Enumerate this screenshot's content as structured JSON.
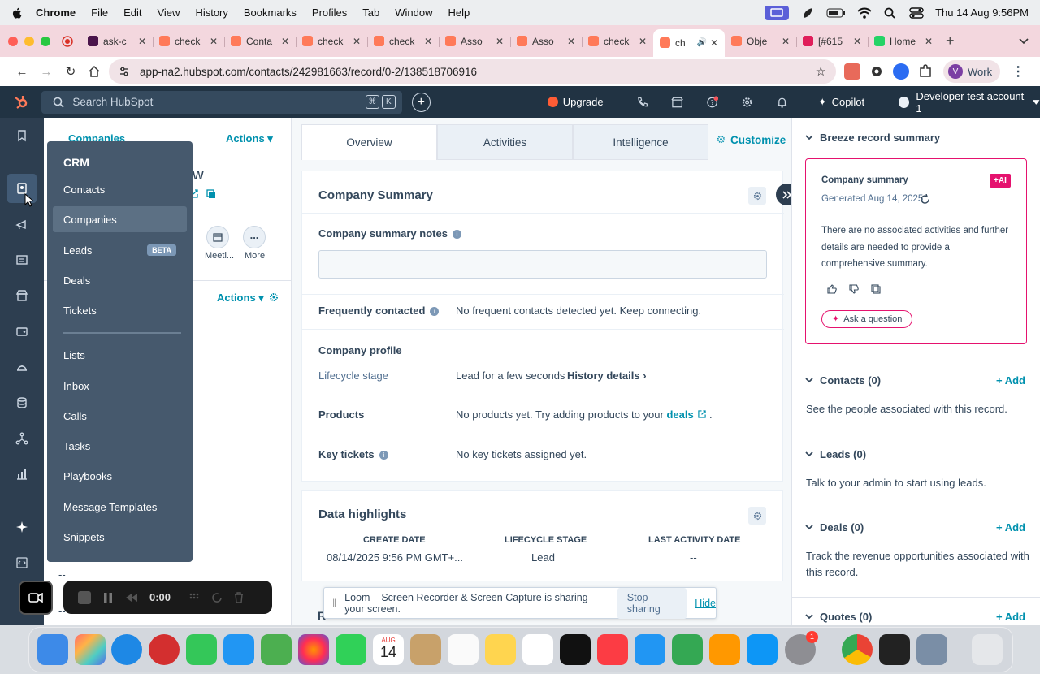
{
  "menubar": {
    "app": "Chrome",
    "items": [
      "File",
      "Edit",
      "View",
      "History",
      "Bookmarks",
      "Profiles",
      "Tab",
      "Window",
      "Help"
    ],
    "datetime": "Thu 14 Aug  9:56PM"
  },
  "tabs": [
    {
      "label": "ask-c",
      "fav": "#4a154b"
    },
    {
      "label": "check",
      "fav": "#ff7a59"
    },
    {
      "label": "Conta",
      "fav": "#ff7a59"
    },
    {
      "label": "check",
      "fav": "#ff7a59"
    },
    {
      "label": "check",
      "fav": "#ff7a59"
    },
    {
      "label": "Asso",
      "fav": "#ff7a59"
    },
    {
      "label": "Asso",
      "fav": "#ff7a59"
    },
    {
      "label": "check",
      "fav": "#ff7a59"
    },
    {
      "label": "ch",
      "fav": "#ff7a59",
      "active": true
    },
    {
      "label": "Obje",
      "fav": "#ff7a59"
    },
    {
      "label": "[#615",
      "fav": "#e01e5a"
    },
    {
      "label": "Home",
      "fav": "#25d366"
    }
  ],
  "address": {
    "url": "app-na2.hubspot.com/contacts/242981663/record/0-2/138518706916",
    "profile_initial": "V",
    "profile_label": "Work"
  },
  "hsnav": {
    "search_placeholder": "Search HubSpot",
    "kbd1": "⌘",
    "kbd2": "K",
    "upgrade": "Upgrade",
    "copilot": "Copilot",
    "account": "Developer test account 1"
  },
  "left": {
    "breadcrumb": "Companies",
    "actions": "Actions",
    "name_fragment": "w",
    "meeting": "Meeti...",
    "more": "More",
    "actions2": "Actions",
    "dash1": "--",
    "dash2": "--"
  },
  "crm": {
    "title": "CRM",
    "beta": "BETA",
    "items": [
      "Contacts",
      "Companies",
      "Leads",
      "Deals",
      "Tickets",
      "Lists",
      "Inbox",
      "Calls",
      "Tasks",
      "Playbooks",
      "Message Templates",
      "Snippets"
    ]
  },
  "center": {
    "tabs": [
      "Overview",
      "Activities",
      "Intelligence"
    ],
    "customize": "Customize",
    "summary_title": "Company Summary",
    "notes_label": "Company summary notes",
    "freq_label": "Frequently contacted",
    "freq_value": "No frequent contacts detected yet. Keep connecting.",
    "profile_label": "Company profile",
    "lifecycle_label": "Lifecycle stage",
    "lifecycle_value": "Lead for a few seconds",
    "history_link": "History details",
    "products_label": "Products",
    "products_value": "No products yet. Try adding products to your",
    "deals_link": "deals",
    "period": ".",
    "tickets_label": "Key tickets",
    "tickets_value": "No key tickets assigned yet.",
    "highlights_title": "Data highlights",
    "highlights": {
      "headers": [
        "CREATE DATE",
        "LIFECYCLE STAGE",
        "LAST ACTIVITY DATE"
      ],
      "values": [
        "08/14/2025 9:56 PM GMT+...",
        "Lead",
        "--"
      ]
    },
    "r_fragment": "R"
  },
  "right": {
    "breeze_title": "Breeze record summary",
    "cs_title": "Company summary",
    "ai_badge": "AI",
    "generated": "Generated Aug 14, 2025",
    "summary_text": "There are no associated activities and further details are needed to provide a comprehensive summary.",
    "ask": "Ask a question",
    "contacts_title": "Contacts (0)",
    "contacts_desc": "See the people associated with this record.",
    "leads_title": "Leads (0)",
    "leads_desc": "Talk to your admin to start using leads.",
    "deals_title": "Deals (0)",
    "deals_desc": "Track the revenue opportunities associated with this record.",
    "quotes_title": "Quotes (0)",
    "add": "+ Add"
  },
  "loom": {
    "timer": "0:00",
    "message": "Loom – Screen Recorder & Screen Capture is sharing your screen.",
    "stop": "Stop sharing",
    "hide": "Hide"
  },
  "dock": {
    "calendar_month": "AUG",
    "calendar_day": "14",
    "chrome_badge": "1"
  },
  "colors": {
    "hubspot_nav": "#213343",
    "accent_link": "#0091ae",
    "hubspot_orange": "#ff7a59",
    "ai_pink": "#e5126e"
  }
}
